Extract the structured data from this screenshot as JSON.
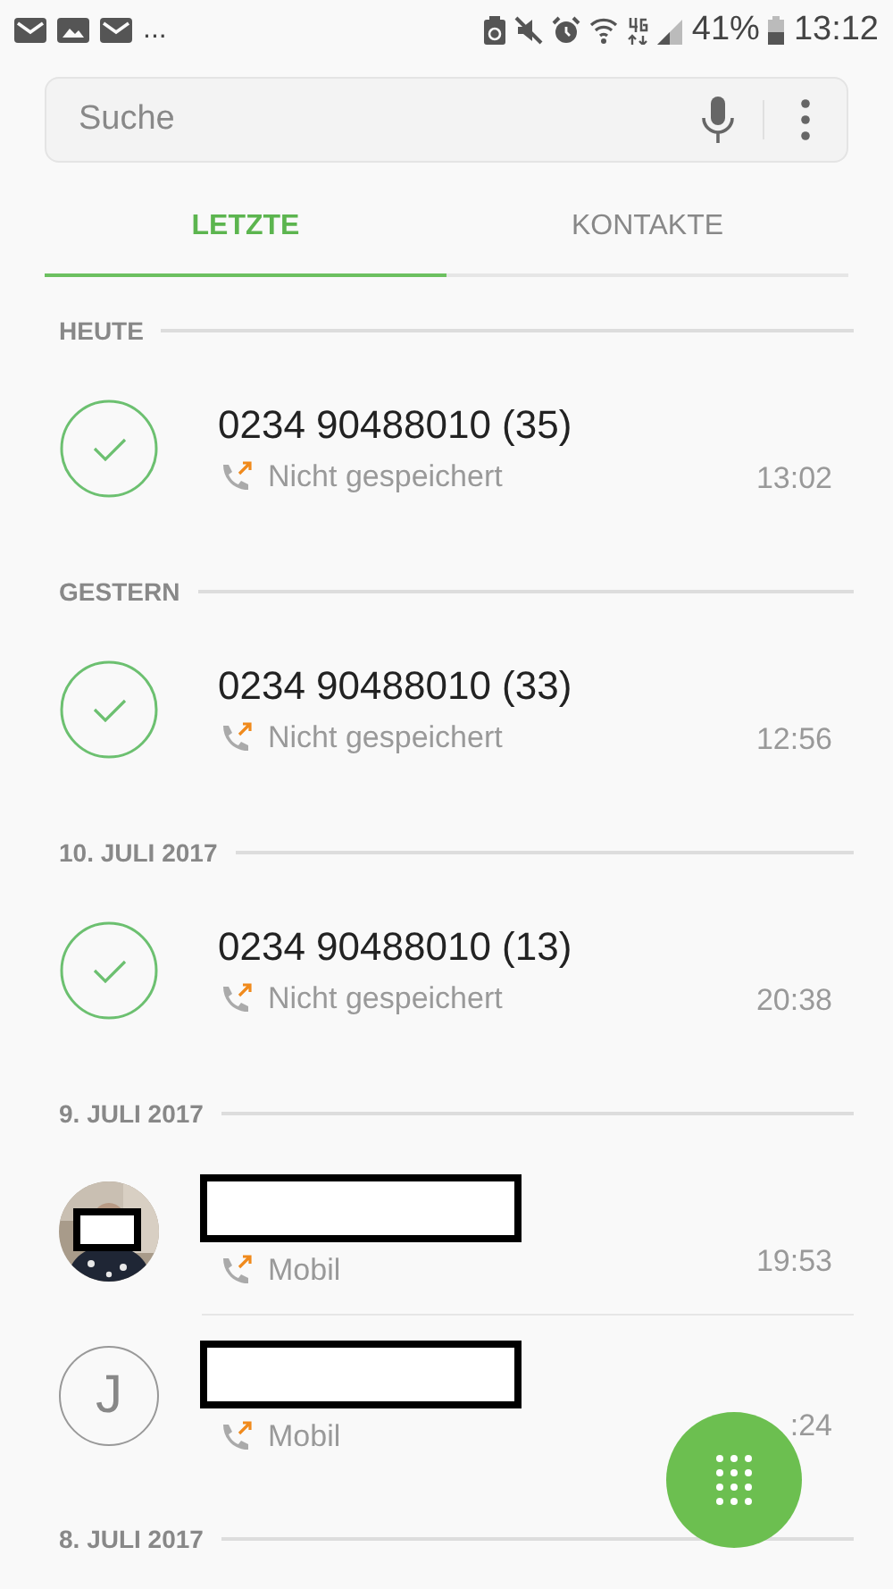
{
  "status_bar": {
    "overflow": "...",
    "battery": "41%",
    "time": "13:12"
  },
  "search": {
    "placeholder": "Suche"
  },
  "tabs": [
    {
      "label": "LETZTE",
      "selected": true
    },
    {
      "label": "KONTAKTE",
      "selected": false
    }
  ],
  "sections": [
    {
      "heading": "HEUTE",
      "calls": [
        {
          "avatar": {
            "kind": "check"
          },
          "title": "0234 90488010 (35)",
          "subtitle": "Nicht gespeichert",
          "time": "13:02"
        }
      ]
    },
    {
      "heading": "GESTERN",
      "calls": [
        {
          "avatar": {
            "kind": "check"
          },
          "title": "0234 90488010 (33)",
          "subtitle": "Nicht gespeichert",
          "time": "12:56"
        }
      ]
    },
    {
      "heading": "10. JULI 2017",
      "calls": [
        {
          "avatar": {
            "kind": "check"
          },
          "title": "0234 90488010 (13)",
          "subtitle": "Nicht gespeichert",
          "time": "20:38"
        }
      ]
    },
    {
      "heading": "9. JULI 2017",
      "calls": [
        {
          "title_redacted": true,
          "subtitle": "Mobil",
          "time": "19:53"
        },
        {
          "avatar": {
            "kind": "letter",
            "letter": "J"
          },
          "title_redacted": true,
          "subtitle": "Mobil",
          "time": ":24"
        }
      ]
    },
    {
      "heading": "8. JULI 2017"
    }
  ]
}
